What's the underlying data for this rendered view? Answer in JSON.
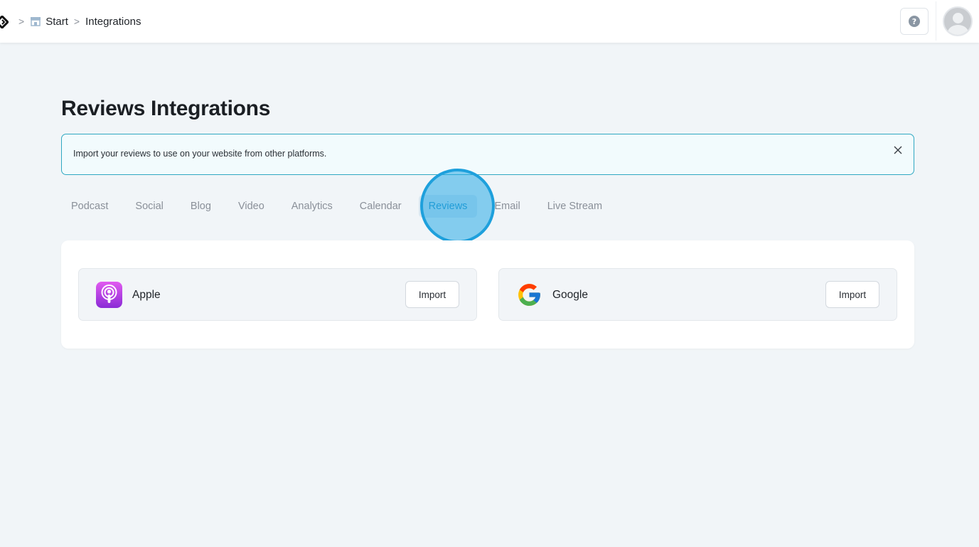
{
  "header": {
    "breadcrumb": {
      "separator": ">",
      "start_label": "Start",
      "current_label": "Integrations"
    },
    "help_label": "?"
  },
  "page": {
    "title": "Reviews Integrations",
    "banner_text": "Import your reviews to use on your website from other platforms."
  },
  "tabs": [
    {
      "label": "Podcast",
      "active": false
    },
    {
      "label": "Social",
      "active": false
    },
    {
      "label": "Blog",
      "active": false
    },
    {
      "label": "Video",
      "active": false
    },
    {
      "label": "Analytics",
      "active": false
    },
    {
      "label": "Calendar",
      "active": false
    },
    {
      "label": "Reviews",
      "active": true
    },
    {
      "label": "Email",
      "active": false
    },
    {
      "label": "Live Stream",
      "active": false
    }
  ],
  "integrations": [
    {
      "name": "Apple",
      "icon": "apple-podcasts-icon",
      "button_label": "Import"
    },
    {
      "name": "Google",
      "icon": "google-icon",
      "button_label": "Import"
    }
  ],
  "colors": {
    "accent": "#1a8ec7",
    "banner_border": "#2fa8c2",
    "background": "#f1f5f8"
  }
}
